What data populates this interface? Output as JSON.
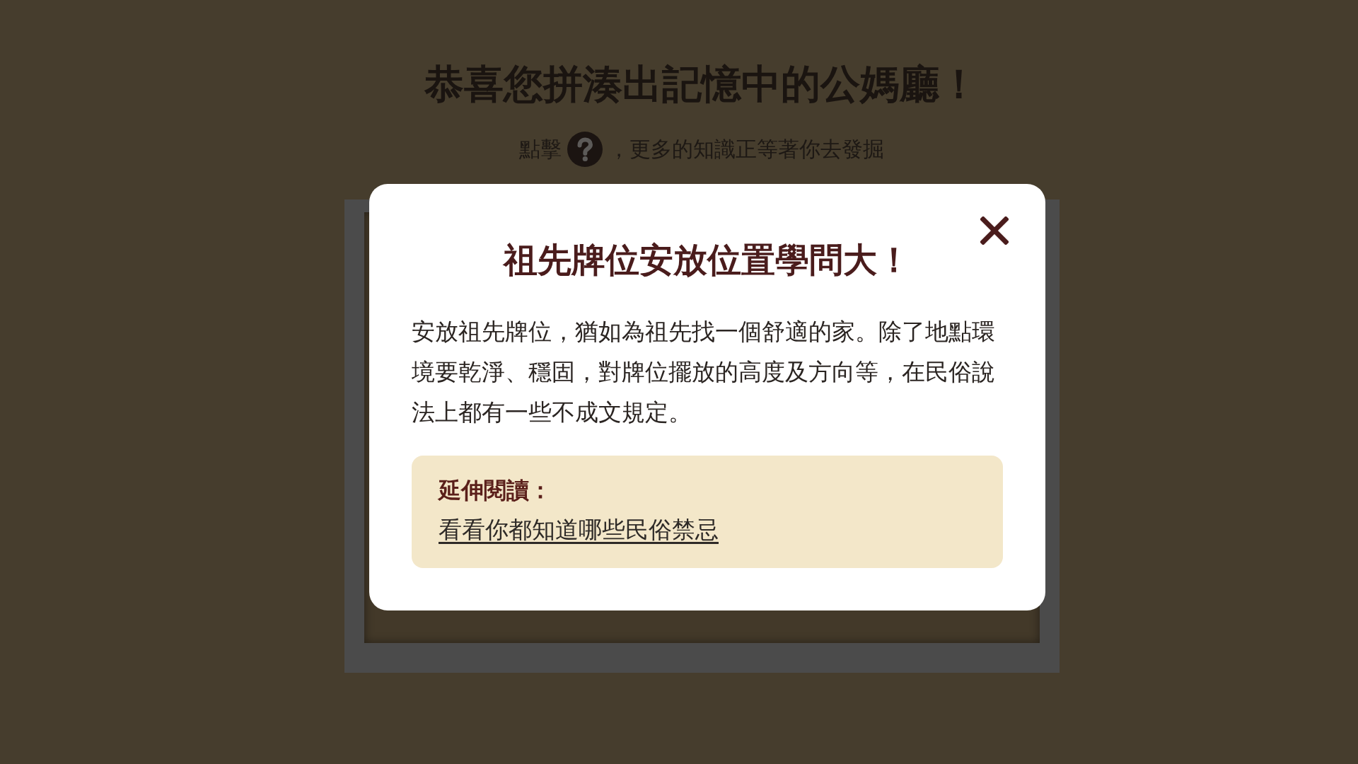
{
  "page": {
    "title": "恭喜您拼湊出記憶中的公媽廳！",
    "hint_before_icon": "點擊",
    "hint_after_icon": "，更多的知識正等著你去發掘"
  },
  "modal": {
    "title": "祖先牌位安放位置學問大！",
    "body": "安放祖先牌位，猶如為祖先找一個舒適的家。除了地點環境要乾淨、穩固，對牌位擺放的高度及方向等，在民俗說法上都有一些不成文規定。",
    "further_reading": {
      "label": "延伸閱讀：",
      "link": "看看你都知道哪些民俗禁忌"
    }
  }
}
